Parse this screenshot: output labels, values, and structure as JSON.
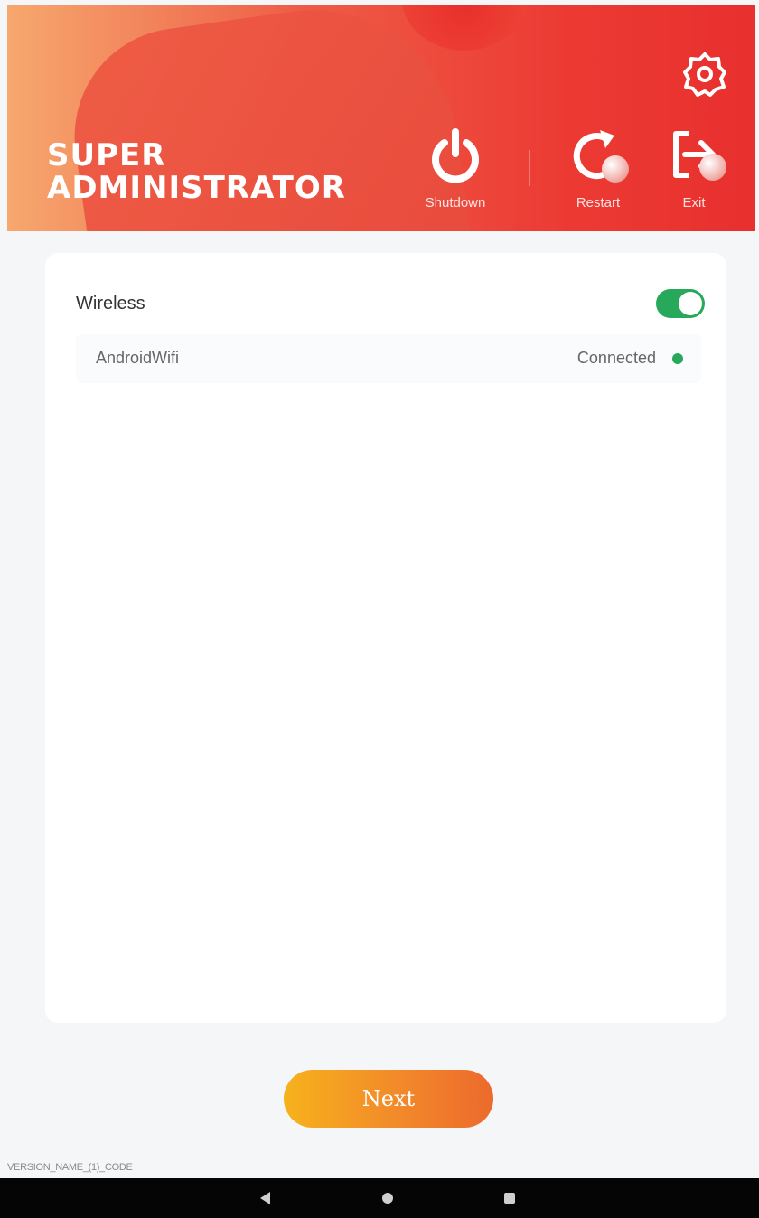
{
  "header": {
    "title_line1": "SUPER",
    "title_line2": "ADMINISTRATOR",
    "settings_icon": "gear-icon",
    "actions": [
      {
        "label": "Shutdown",
        "icon": "power-icon"
      },
      {
        "label": "Restart",
        "icon": "restart-icon"
      },
      {
        "label": "Exit",
        "icon": "exit-icon"
      }
    ]
  },
  "wireless": {
    "label": "Wireless",
    "enabled": true,
    "networks": [
      {
        "name": "AndroidWifi",
        "status": "Connected"
      }
    ]
  },
  "footer": {
    "next_label": "Next",
    "version_text": "VERSION_NAME_(1)_CODE"
  },
  "colors": {
    "accent_red": "#e8302e",
    "toggle_green": "#27a85a",
    "button_orange": "#f2892a"
  },
  "navbar": {
    "back_icon": "back-triangle-icon",
    "home_icon": "home-circle-icon",
    "recent_icon": "recents-square-icon"
  }
}
